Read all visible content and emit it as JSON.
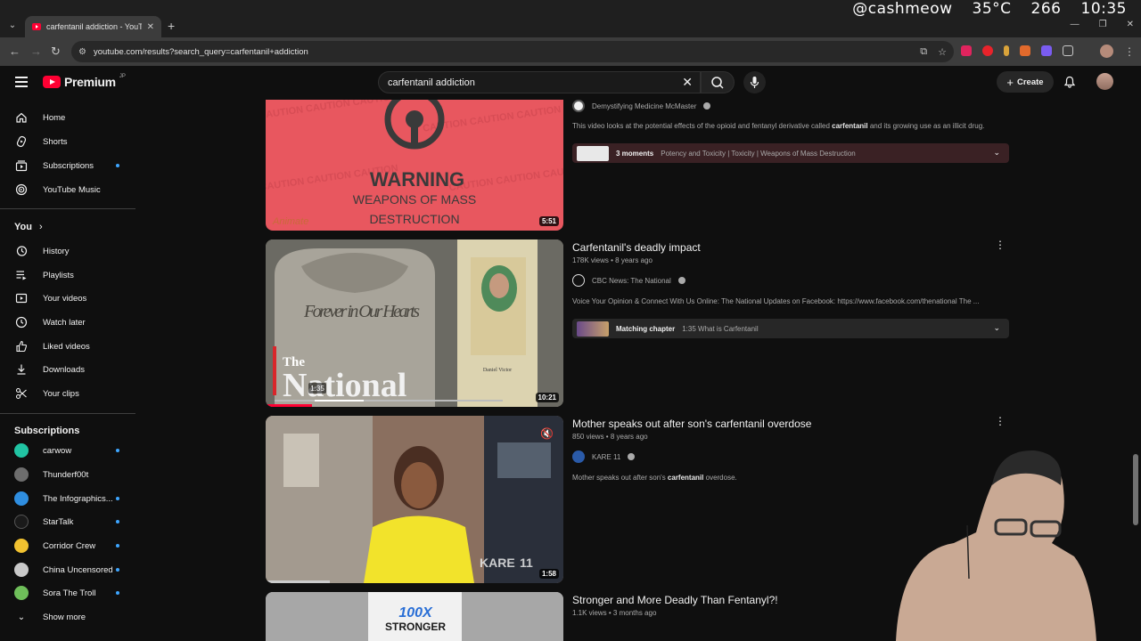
{
  "browser": {
    "tab_title": "carfentanil addiction - YouTube",
    "url": "youtube.com/results?search_query=carfentanil+addiction",
    "overlay": {
      "handle": "@cashmeow",
      "temp": "35°C",
      "count": "266",
      "time": "10:35"
    }
  },
  "masthead": {
    "logo_text": "Premium",
    "logo_region": "JP",
    "search_query": "carfentanil addiction",
    "create_label": "Create"
  },
  "sidebar": {
    "main": [
      {
        "label": "Home",
        "icon": "home-icon"
      },
      {
        "label": "Shorts",
        "icon": "shorts-icon"
      },
      {
        "label": "Subscriptions",
        "icon": "subscriptions-icon"
      },
      {
        "label": "YouTube Music",
        "icon": "music-icon"
      }
    ],
    "you_heading": "You",
    "you": [
      {
        "label": "History",
        "icon": "history-icon"
      },
      {
        "label": "Playlists",
        "icon": "playlists-icon"
      },
      {
        "label": "Your videos",
        "icon": "your-videos-icon"
      },
      {
        "label": "Watch later",
        "icon": "clock-icon"
      },
      {
        "label": "Liked videos",
        "icon": "thumbs-up-icon"
      },
      {
        "label": "Downloads",
        "icon": "download-icon"
      },
      {
        "label": "Your clips",
        "icon": "scissors-icon"
      }
    ],
    "subs_heading": "Subscriptions",
    "subscriptions": [
      {
        "label": "carwow",
        "color": "#21c4a3"
      },
      {
        "label": "Thunderf00t",
        "color": "#6d6d6d"
      },
      {
        "label": "The Infographics...",
        "color": "#2f8ee0"
      },
      {
        "label": "StarTalk",
        "color": "#1a1a1a"
      },
      {
        "label": "Corridor Crew",
        "color": "#f2c230"
      },
      {
        "label": "China Uncensored",
        "color": "#c9c9c9"
      },
      {
        "label": "Sora The Troll",
        "color": "#6fbf5a"
      }
    ],
    "show_more": "Show more"
  },
  "results": [
    {
      "duration": "5:51",
      "channel": "Demystifying Medicine McMaster",
      "description_pre": "This video looks at the potential effects of the opioid and fentanyl derivative called ",
      "description_bold": "carfentanil",
      "description_post": " and its growing use as an illicit drug.",
      "chapter_label": "3 moments",
      "chapter_text": "Potency and Toxicity | Toxicity | Weapons of Mass Destruction",
      "thumb_text_1": "WARNING",
      "thumb_text_2": "WEAPONS OF MASS",
      "thumb_text_3": "DESTRUCTION",
      "thumb_caution": "CAUTION CAUTION CAUTION",
      "thumb_brand": "Animate"
    },
    {
      "title": "Carfentanil's deadly impact",
      "meta": "178K views • 8 years ago",
      "duration": "10:21",
      "channel": "CBC News: The National",
      "description": "Voice Your Opinion & Connect With Us Online: The National Updates on Facebook: https://www.facebook.com/thenational The ...",
      "chapter_label": "Matching chapter",
      "chapter_text": "1:35 What is Carfentanil",
      "thumb_stone": "Forever in Our Hearts",
      "thumb_brand_small": "The",
      "thumb_brand": "National",
      "thumb_time": "1:35",
      "thumb_candle": "Daniel Victor"
    },
    {
      "title": "Mother speaks out after son's carfentanil overdose",
      "meta": "850 views • 8 years ago",
      "duration": "1:58",
      "channel": "KARE 11",
      "description_pre": "Mother speaks out after son's ",
      "description_bold": "carfentanil",
      "description_post": " overdose.",
      "thumb_brand": "KARE",
      "thumb_brand_number": "11"
    },
    {
      "title": "Stronger and More Deadly Than Fentanyl?!",
      "meta": "1.1K views • 3 months ago",
      "thumb_text_1": "100X",
      "thumb_text_2": "STRONGER"
    }
  ]
}
